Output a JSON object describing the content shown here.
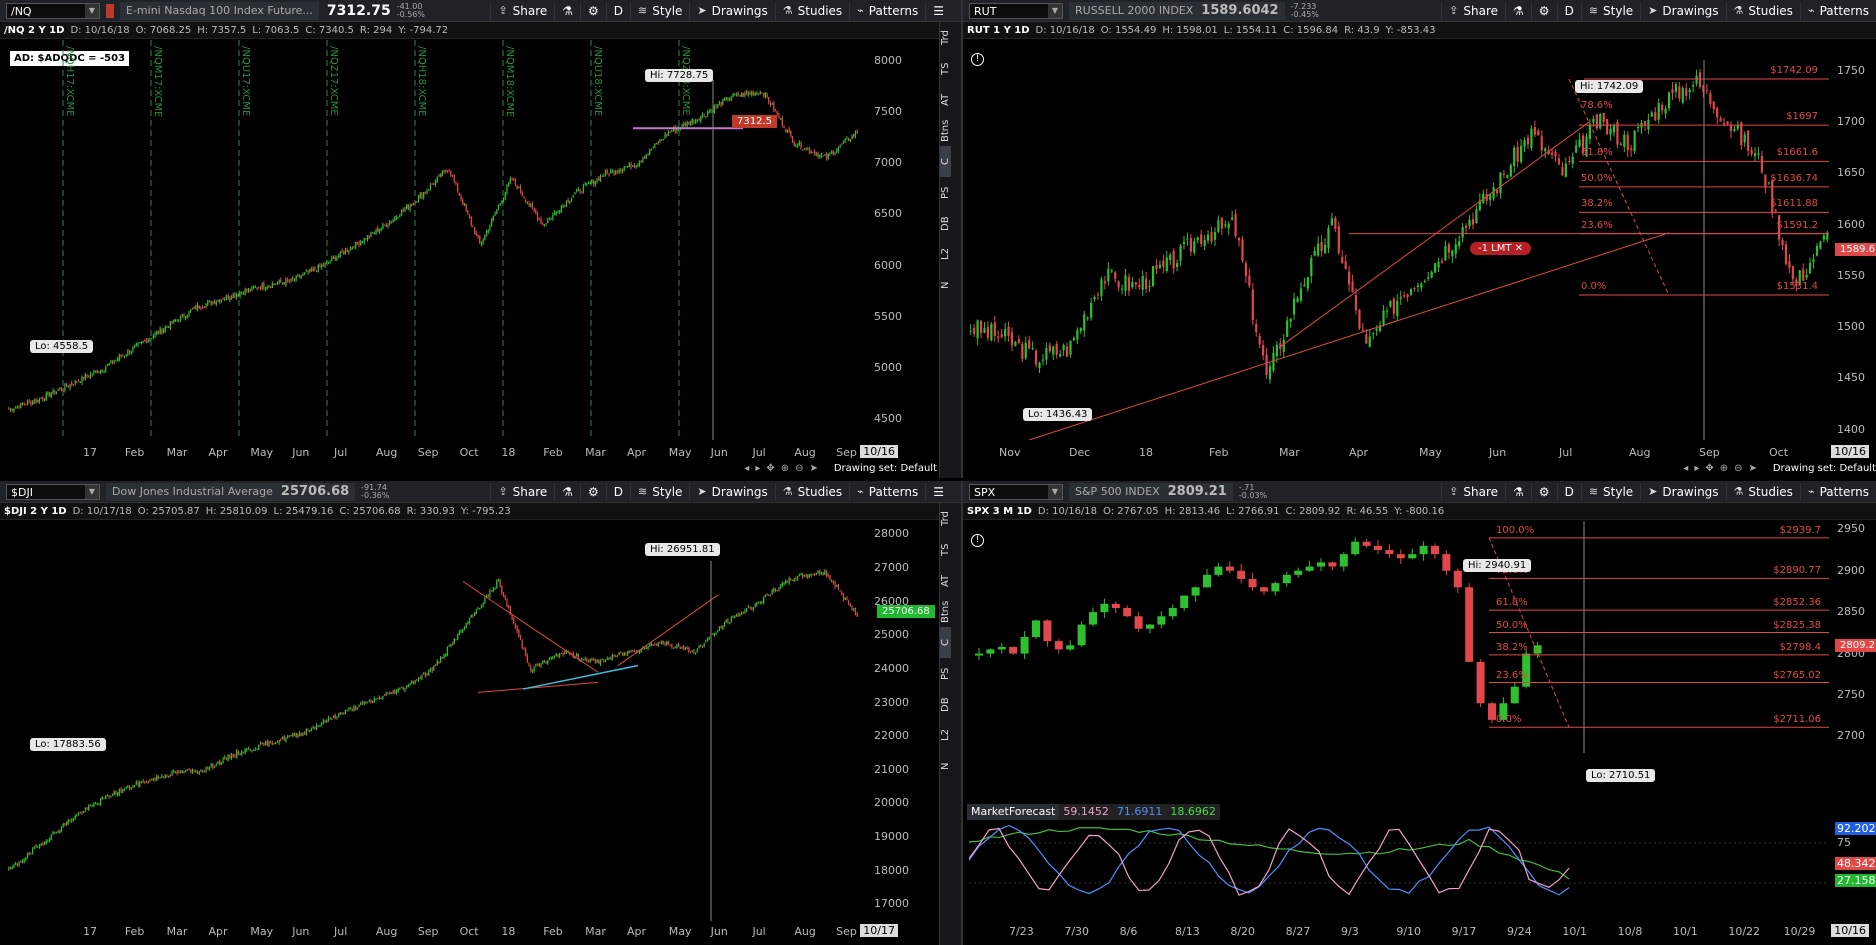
{
  "panes": [
    {
      "id": "nq",
      "symbol": "/NQ",
      "description": "E-mini Nasdaq 100 Index Future...",
      "last": "7312.75",
      "change": "-41.00",
      "change_pct": "-0.56%",
      "info": {
        "title": "/NQ 2 Y 1D",
        "d": "D: 10/16/18",
        "o": "O: 7068.25",
        "h": "H: 7357.5",
        "l": "L: 7063.5",
        "c": "C: 7340.5",
        "r": "R: 294",
        "y": "Y: -794.72"
      },
      "ad_label": "AD: $ADQDC = -503",
      "y_ticks": [
        "8000",
        "7500",
        "7000",
        "6500",
        "6000",
        "5500",
        "5000",
        "4500"
      ],
      "x_ticks": [
        "17",
        "Feb",
        "Mar",
        "Apr",
        "May",
        "Jun",
        "Jul",
        "Aug",
        "Sep",
        "Oct",
        "18",
        "Feb",
        "Mar",
        "Apr",
        "May",
        "Jun",
        "Jul",
        "Aug",
        "Sep"
      ],
      "x_date_tag": "10/16",
      "hi_label": "Hi: 7728.75",
      "lo_label": "Lo: 4558.5",
      "price_tag": "7312.5",
      "expiries": [
        "/NQH17:XCME",
        "/NQM17:XCME",
        "/NQU17:XCME",
        "/NQZ17:XCME",
        "/NQH18:XCME",
        "/NQM18:XCME",
        "/NQU18:XCME",
        "/NQZ18:XCME"
      ],
      "drawing_set": "Drawing set: Default",
      "chart_data": {
        "type": "candlestick",
        "ylim": [
          4300,
          8200
        ],
        "hi": 7728.75,
        "lo": 4558.5,
        "last": 7312.5
      }
    },
    {
      "id": "rut",
      "symbol": "RUT",
      "description": "RUSSELL 2000 INDEX",
      "last": "1589.6042",
      "change": "-7.233",
      "change_pct": "-0.45%",
      "info": {
        "title": "RUT 1 Y 1D",
        "d": "D: 10/16/18",
        "o": "O: 1554.49",
        "h": "H: 1598.01",
        "l": "L: 1554.11",
        "c": "C: 1596.84",
        "r": "R: 43.9",
        "y": "Y: -853.43"
      },
      "y_ticks": [
        "1750",
        "1700",
        "1650",
        "1600",
        "1550",
        "1500",
        "1450",
        "1400"
      ],
      "x_ticks": [
        "Nov",
        "Dec",
        "18",
        "Feb",
        "Mar",
        "Apr",
        "May",
        "Jun",
        "Jul",
        "Aug",
        "Sep",
        "Oct"
      ],
      "x_date_tag": "10/16",
      "hi_label": "Hi: 1742.09",
      "lo_label": "Lo: 1436.43",
      "price_tag": "1589.6",
      "order_label": "-1 LMT",
      "fib_pct": [
        "78.6%",
        "61.8%",
        "50.0%",
        "38.2%",
        "23.6%",
        "0.0%"
      ],
      "fib_vals": [
        "$1742.09",
        "$1697",
        "$1661.6",
        "$1636.74",
        "$1611.88",
        "$1591.2",
        "$1531.4"
      ],
      "drawing_set": "Drawing set: Default",
      "chart_data": {
        "type": "candlestick",
        "ylim": [
          1390,
          1780
        ],
        "hi": 1742.09,
        "lo": 1436.43,
        "last": 1589.6
      }
    },
    {
      "id": "dji",
      "symbol": "$DJI",
      "description": "Dow Jones Industrial Average",
      "last": "25706.68",
      "change": "-91.74",
      "change_pct": "-0.36%",
      "info": {
        "title": "$DJI 2 Y 1D",
        "d": "D: 10/17/18",
        "o": "O: 25705.87",
        "h": "H: 25810.09",
        "l": "L: 25479.16",
        "c": "C: 25706.68",
        "r": "R: 330.93",
        "y": "Y: -795.23"
      },
      "y_ticks": [
        "28000",
        "27000",
        "26000",
        "25000",
        "24000",
        "23000",
        "22000",
        "21000",
        "20000",
        "19000",
        "18000",
        "17000"
      ],
      "x_ticks": [
        "17",
        "Feb",
        "Mar",
        "Apr",
        "May",
        "Jun",
        "Jul",
        "Aug",
        "Sep",
        "Oct",
        "18",
        "Feb",
        "Mar",
        "Apr",
        "May",
        "Jun",
        "Jul",
        "Aug",
        "Sep"
      ],
      "x_date_tag": "10/17",
      "hi_label": "Hi: 26951.81",
      "lo_label": "Lo: 17883.56",
      "price_tag": "25706.68",
      "chart_data": {
        "type": "candlestick",
        "ylim": [
          16500,
          28400
        ],
        "hi": 26951.81,
        "lo": 17883.56,
        "last": 25706.68
      }
    },
    {
      "id": "spx",
      "symbol": "SPX",
      "description": "S&P 500 INDEX",
      "last": "2809.21",
      "change": "-.71",
      "change_pct": "-0.03%",
      "info": {
        "title": "SPX 3 M 1D",
        "d": "D: 10/16/18",
        "o": "O: 2767.05",
        "h": "H: 2813.46",
        "l": "L: 2766.91",
        "c": "C: 2809.92",
        "r": "R: 46.55",
        "y": "Y: -800.16"
      },
      "y_ticks": [
        "2950",
        "2900",
        "2850",
        "2800",
        "2750",
        "2700"
      ],
      "x_ticks": [
        "7/23",
        "7/30",
        "8/6",
        "8/13",
        "8/20",
        "8/27",
        "9/3",
        "9/10",
        "9/17",
        "9/24",
        "10/1",
        "10/8",
        "10/1",
        "10/22",
        "10/29"
      ],
      "x_date_tag": "10/16",
      "hi_label": "Hi: 2940.91",
      "lo_label": "Lo: 2710.51",
      "price_tag": "2809.21",
      "fib_pct": [
        "100.0%",
        "78.6%",
        "61.8%",
        "50.0%",
        "38.2%",
        "23.6%",
        "0.0%"
      ],
      "fib_vals": [
        "$2939.7",
        "$2890.77",
        "$2852.36",
        "$2825.38",
        "$2798.4",
        "$2765.02",
        "$2711.06"
      ],
      "indicator": {
        "name": "MarketForecast",
        "v1": "59.1452",
        "v2": "71.6911",
        "v3": "18.6962",
        "tags": [
          "92.202",
          "75",
          "48.3429",
          "27.1589"
        ]
      },
      "chart_data": {
        "type": "candlestick",
        "ylim": [
          2680,
          2960
        ],
        "hi": 2940.91,
        "lo": 2710.51,
        "last": 2809.21
      }
    }
  ],
  "toolbar": {
    "share": "Share",
    "d": "D",
    "style": "Style",
    "drawings": "Drawings",
    "studies": "Studies",
    "patterns": "Patterns"
  },
  "side_tabs": [
    "Trd",
    "TS",
    "AT",
    "Btns",
    "C",
    "PS",
    "DB",
    "L2",
    "N"
  ],
  "colors": {
    "up": "#2ec02e",
    "down": "#e2474b",
    "fib": "#e04848",
    "accent": "#c478d4"
  }
}
